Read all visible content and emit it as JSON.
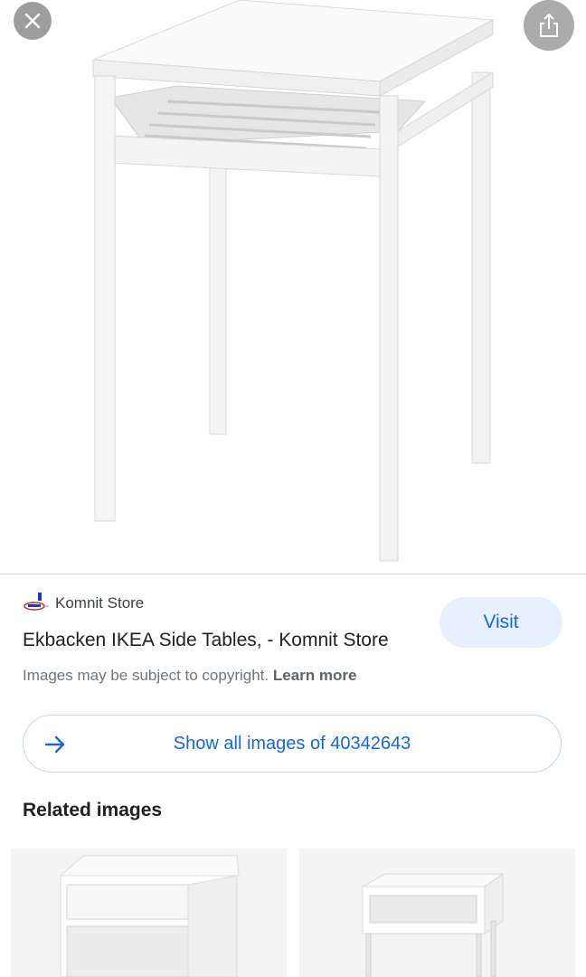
{
  "toolbar": {
    "close_icon": "close-icon",
    "share_icon": "share-icon"
  },
  "source": {
    "logo_icon": "komnit-logo",
    "name": "Komnit Store"
  },
  "result": {
    "title": "Ekbacken IKEA Side Tables, - Komnit Store",
    "visit_label": "Visit",
    "copyright_text": "Images may be subject to copyright.",
    "learn_more_label": "Learn more"
  },
  "show_all": {
    "icon": "arrow-right-icon",
    "label": "Show all images of 40342643"
  },
  "related": {
    "heading": "Related images"
  },
  "colors": {
    "accent": "#1967d2",
    "visit_bg": "#e8f0fe",
    "overlay_button": "#8c8c8c"
  }
}
